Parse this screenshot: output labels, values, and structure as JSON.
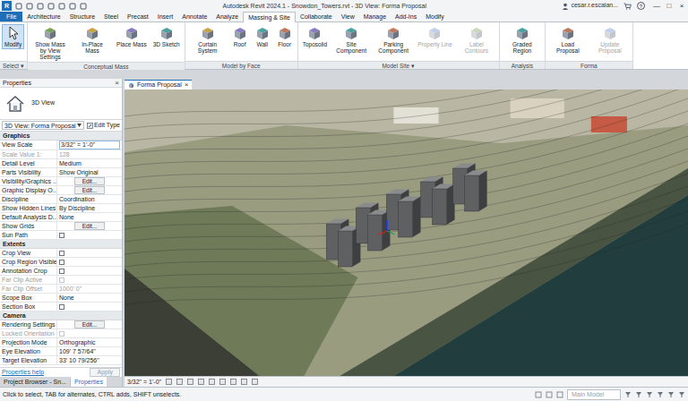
{
  "window": {
    "logo": "R",
    "title": "Autodesk Revit 2024.1 - Snowdon_Towers.rvt - 3D View: Forma Proposal",
    "user": "cesar.r.escalan...",
    "help": "?",
    "controls": [
      "—",
      "□",
      "×"
    ]
  },
  "ribbon": {
    "app_menu": "File",
    "tabs": [
      {
        "label": "Architecture",
        "selected": false
      },
      {
        "label": "Structure",
        "selected": false
      },
      {
        "label": "Steel",
        "selected": false
      },
      {
        "label": "Precast",
        "selected": false
      },
      {
        "label": "Insert",
        "selected": false
      },
      {
        "label": "Annotate",
        "selected": false
      },
      {
        "label": "Analyze",
        "selected": false
      },
      {
        "label": "Massing & Site",
        "selected": true
      },
      {
        "label": "Collaborate",
        "selected": false
      },
      {
        "label": "View",
        "selected": false
      },
      {
        "label": "Manage",
        "selected": false
      },
      {
        "label": "Add-Ins",
        "selected": false
      },
      {
        "label": "Modify",
        "selected": false
      }
    ],
    "panels": [
      {
        "label": "Select",
        "dropdown": "▾",
        "tools": [
          {
            "label": "Modify",
            "disabled": false,
            "selected": true
          }
        ]
      },
      {
        "label": "Conceptual Mass",
        "tools": [
          {
            "label": "Show Mass by View Settings",
            "disabled": false,
            "selected": false
          },
          {
            "label": "In-Place Mass",
            "disabled": false,
            "selected": false
          },
          {
            "label": "Place Mass",
            "disabled": false,
            "selected": false
          },
          {
            "label": "3D Sketch",
            "disabled": false,
            "selected": false
          }
        ]
      },
      {
        "label": "Model by Face",
        "tools": [
          {
            "label": "Curtain System",
            "disabled": false,
            "selected": false
          },
          {
            "label": "Roof",
            "disabled": false,
            "selected": false
          },
          {
            "label": "Wall",
            "disabled": false,
            "selected": false
          },
          {
            "label": "Floor",
            "disabled": false,
            "selected": false
          }
        ]
      },
      {
        "label": "Model Site",
        "dropdown": "▾",
        "tools": [
          {
            "label": "Toposolid",
            "disabled": false,
            "selected": false
          },
          {
            "label": "Site Component",
            "disabled": false,
            "selected": false
          },
          {
            "label": "Parking Component",
            "disabled": false,
            "selected": false
          },
          {
            "label": "Property Line",
            "disabled": true,
            "selected": false
          },
          {
            "label": "Label Contours",
            "disabled": true,
            "selected": false
          }
        ]
      },
      {
        "label": "Analysis",
        "tools": [
          {
            "label": "Graded Region",
            "disabled": false,
            "selected": false
          }
        ]
      },
      {
        "label": "Forma",
        "tools": [
          {
            "label": "Load Proposal",
            "disabled": false,
            "selected": false
          },
          {
            "label": "Update Proposal",
            "disabled": true,
            "selected": false
          }
        ]
      }
    ]
  },
  "properties": {
    "title": "Properties",
    "close": "×",
    "type": "3D View",
    "instance": "3D View: Forma Proposal",
    "edit_type": "Edit Type",
    "rows": [
      {
        "kind": "section",
        "label": "Graphics"
      },
      {
        "kind": "input",
        "label": "View Scale",
        "value": "3/32\" = 1'-0\"",
        "disabled": false
      },
      {
        "kind": "text",
        "label": "Scale Value 1:",
        "value": "128",
        "disabled": true
      },
      {
        "kind": "text",
        "label": "Detail Level",
        "value": "Medium",
        "disabled": false
      },
      {
        "kind": "text",
        "label": "Parts Visibility",
        "value": "Show Original",
        "disabled": false
      },
      {
        "kind": "button",
        "label": "Visibility/Graphics ...",
        "value": "Edit...",
        "disabled": false
      },
      {
        "kind": "button",
        "label": "Graphic Display O...",
        "value": "Edit...",
        "disabled": false
      },
      {
        "kind": "text",
        "label": "Discipline",
        "value": "Coordination",
        "disabled": false
      },
      {
        "kind": "text",
        "label": "Show Hidden Lines",
        "value": "By Discipline",
        "disabled": false
      },
      {
        "kind": "text",
        "label": "Default Analysis D...",
        "value": "None",
        "disabled": false
      },
      {
        "kind": "button",
        "label": "Show Grids",
        "value": "Edit...",
        "disabled": false
      },
      {
        "kind": "checkbox",
        "label": "Sun Path",
        "checked": false,
        "disabled": false
      },
      {
        "kind": "section",
        "label": "Extents"
      },
      {
        "kind": "checkbox",
        "label": "Crop View",
        "checked": false,
        "disabled": false
      },
      {
        "kind": "checkbox",
        "label": "Crop Region Visible",
        "checked": false,
        "disabled": false
      },
      {
        "kind": "checkbox",
        "label": "Annotation Crop",
        "checked": false,
        "disabled": false
      },
      {
        "kind": "checkbox",
        "label": "Far Clip Active",
        "checked": false,
        "disabled": true
      },
      {
        "kind": "text",
        "label": "Far Clip Offset",
        "value": "1000' 0\"",
        "disabled": true
      },
      {
        "kind": "text",
        "label": "Scope Box",
        "value": "None",
        "disabled": false
      },
      {
        "kind": "checkbox",
        "label": "Section Box",
        "checked": false,
        "disabled": false
      },
      {
        "kind": "section",
        "label": "Camera"
      },
      {
        "kind": "button",
        "label": "Rendering Settings",
        "value": "Edit...",
        "disabled": false
      },
      {
        "kind": "checkbox",
        "label": "Locked Orientation",
        "checked": false,
        "disabled": true
      },
      {
        "kind": "text",
        "label": "Projection Mode",
        "value": "Orthographic",
        "disabled": false
      },
      {
        "kind": "text",
        "label": "Eye Elevation",
        "value": "109' 7 57/64\"",
        "disabled": false
      },
      {
        "kind": "text",
        "label": "Target Elevation",
        "value": "33' 10 79/256\"",
        "disabled": false
      }
    ],
    "help": "Properties help",
    "apply": {
      "label": "Apply",
      "disabled": true
    },
    "bottom_tabs": [
      {
        "label": "Project Browser - Sn...",
        "selected": false
      },
      {
        "label": "Properties",
        "selected": true
      }
    ]
  },
  "view": {
    "tab": "Forma Proposal",
    "close": "×",
    "scale": "3/32\" = 1'-0\""
  },
  "status_bar": {
    "hint": "Click to select, TAB for alternates, CTRL adds, SHIFT unselects.",
    "model": "Main Model"
  }
}
